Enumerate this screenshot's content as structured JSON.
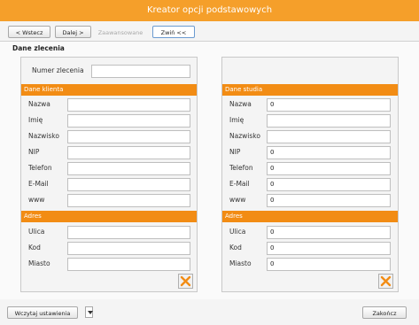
{
  "window": {
    "title": "Kreator opcji podstawowych"
  },
  "toolbar": {
    "back_label": "< Wstecz",
    "next_label": "Dalej >",
    "advanced_label": "Zaawansowane",
    "collapse_label": "Zwiń <<"
  },
  "section": {
    "title": "Dane zlecenia"
  },
  "order": {
    "number_label": "Numer zlecenia",
    "number_value": ""
  },
  "client": {
    "header": "Dane klienta",
    "fields": [
      {
        "label": "Nazwa",
        "value": ""
      },
      {
        "label": "Imię",
        "value": ""
      },
      {
        "label": "Nazwisko",
        "value": ""
      },
      {
        "label": "NIP",
        "value": ""
      },
      {
        "label": "Telefon",
        "value": ""
      },
      {
        "label": "E-Mail",
        "value": ""
      },
      {
        "label": "www",
        "value": ""
      }
    ],
    "address_header": "Adres",
    "address": [
      {
        "label": "Ulica",
        "value": ""
      },
      {
        "label": "Kod",
        "value": ""
      },
      {
        "label": "Miasto",
        "value": ""
      }
    ]
  },
  "studio": {
    "header": "Dane studia",
    "fields": [
      {
        "label": "Nazwa",
        "value": "0"
      },
      {
        "label": "Imię",
        "value": ""
      },
      {
        "label": "Nazwisko",
        "value": ""
      },
      {
        "label": "NIP",
        "value": "0"
      },
      {
        "label": "Telefon",
        "value": "0"
      },
      {
        "label": "E-Mail",
        "value": "0"
      },
      {
        "label": "www",
        "value": "0"
      }
    ],
    "address_header": "Adres",
    "address": [
      {
        "label": "Ulica",
        "value": "0"
      },
      {
        "label": "Kod",
        "value": "0"
      },
      {
        "label": "Miasto",
        "value": "0"
      }
    ]
  },
  "footer": {
    "load_settings_label": "Wczytaj ustawienia",
    "finish_label": "Zakończ"
  },
  "colors": {
    "accent": "#f59f2a",
    "section_bar": "#f28c14"
  },
  "icons": {
    "clear": "clear-icon",
    "dropdown": "chevron-down-icon"
  }
}
